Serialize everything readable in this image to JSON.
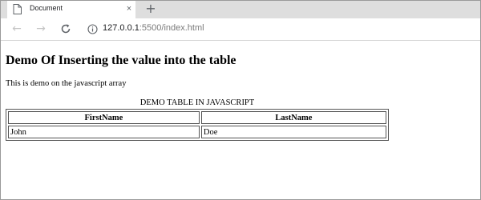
{
  "browser": {
    "tab_title": "Document",
    "tab_close": "×",
    "new_tab": "+",
    "url_host": "127.0.0.1",
    "url_rest": ":5500/index.html"
  },
  "page": {
    "heading": "Demo Of Inserting the value into the table",
    "description": "This is demo on the javascript array",
    "table": {
      "caption": "DEMO TABLE IN JAVASCRIPT",
      "headers": [
        "FirstName",
        "LastName"
      ],
      "rows": [
        [
          "John",
          "Doe"
        ]
      ]
    }
  }
}
